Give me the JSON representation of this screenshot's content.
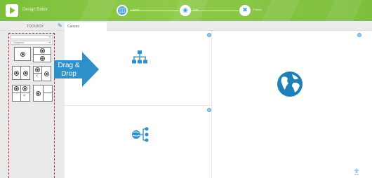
{
  "header": {
    "app_title": "Design Editor",
    "steps": [
      {
        "icon": "layout-step-icon",
        "label": "Layout",
        "active": true
      },
      {
        "icon": "edit-step-icon",
        "label": "Edit",
        "active": false
      },
      {
        "icon": "publish-step-icon",
        "label": "Publish",
        "active": false
      }
    ]
  },
  "tabs": {
    "toolbox": "TOOLBOX",
    "canvas": "Canvas"
  },
  "toolbox": {
    "select_1": "",
    "select_2": "Categories"
  },
  "callout": {
    "line1": "Drag &",
    "line2": "Drop"
  },
  "colors": {
    "brand_green": "#7cc03a",
    "accent_blue": "#2f8fcb",
    "frame_red": "#d4252a"
  },
  "icons": [
    "sitemap-icon",
    "network-globe-icon",
    "globe-icon",
    "settings-dot-icon",
    "upload-icon"
  ]
}
